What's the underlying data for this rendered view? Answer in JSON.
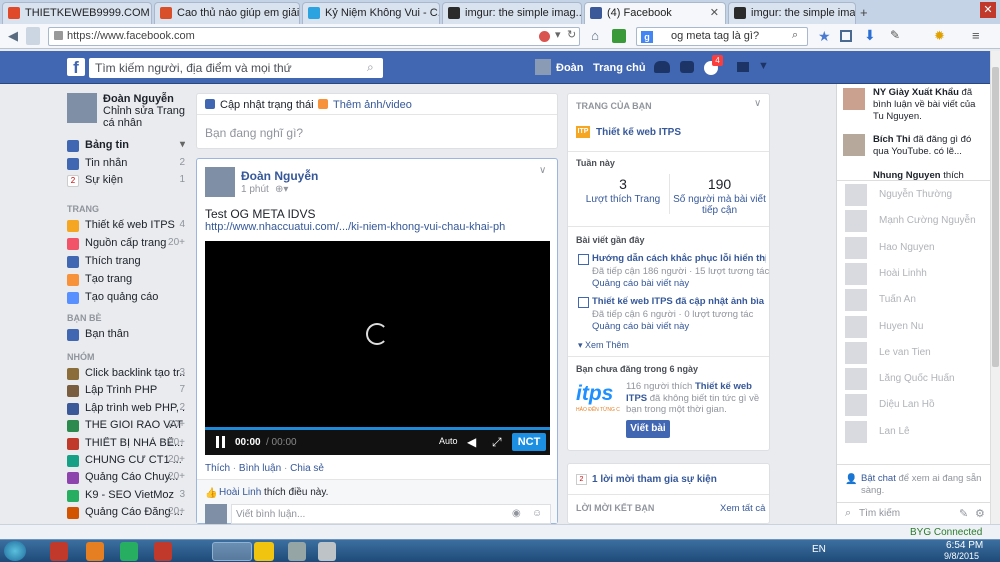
{
  "browser": {
    "tabs": [
      {
        "label": "THIETKEWEB9999.COM",
        "active": false
      },
      {
        "label": "Cao thủ nào giúp em giải th...",
        "active": false
      },
      {
        "label": "Kỷ Niệm Không Vui - C...",
        "active": false
      },
      {
        "label": "imgur: the simple imag...",
        "active": false
      },
      {
        "label": "(4) Facebook",
        "active": true
      },
      {
        "label": "imgur: the simple imag...",
        "active": false
      }
    ],
    "url": "https://www.facebook.com",
    "search_value": "og meta tag là gì?"
  },
  "fb_header": {
    "logo": "f",
    "search_placeholder": "Tìm kiếm người, địa điểm và mọi thứ",
    "profile_name": "Đoàn",
    "home": "Trang chủ",
    "notif_count": "4"
  },
  "left": {
    "profile_name": "Đoàn Nguyễn",
    "edit_profile": "Chỉnh sửa Trang cá nhân",
    "main_items": [
      {
        "label": "Bảng tin",
        "count": "",
        "color": "#4267b2",
        "bold": true
      },
      {
        "label": "Tin nhắn",
        "count": "2",
        "color": "#4267b2"
      },
      {
        "label": "Sự kiện",
        "count": "1",
        "color": "#ffffff"
      }
    ],
    "pages_header": "TRANG",
    "pages_items": [
      {
        "label": "Thiết kế web ITPS",
        "count": "4",
        "color": "#f5a623"
      },
      {
        "label": "Nguồn cấp trang",
        "count": "20+",
        "color": "#f35369"
      },
      {
        "label": "Thích trang",
        "count": "",
        "color": "#4267b2"
      },
      {
        "label": "Tạo trang",
        "count": "",
        "color": "#f7923a"
      },
      {
        "label": "Tạo quảng cáo",
        "count": "",
        "color": "#5890ff"
      }
    ],
    "friends_header": "BẠN BÈ",
    "friends_items": [
      {
        "label": "Bạn thân",
        "count": "",
        "color": "#4267b2"
      }
    ],
    "groups_header": "NHÓM",
    "groups_items": [
      {
        "label": "Click backlink tạo tr...",
        "count": "3",
        "color": "#8a6d3b"
      },
      {
        "label": "Lập Trình PHP",
        "count": "7",
        "color": "#7a5c3e"
      },
      {
        "label": "Lập trình web PHP, ...",
        "count": "2",
        "color": "#3b5998"
      },
      {
        "label": "THE GIOI RAO VAT",
        "count": "20+",
        "color": "#2d8a4e"
      },
      {
        "label": "THIẾT BỊ NHÀ BẾ...",
        "count": "20+",
        "color": "#c0392b"
      },
      {
        "label": "CHUNG CƯ CT1 ...",
        "count": "20+",
        "color": "#16a085"
      },
      {
        "label": "Quảng Cáo Chuy...",
        "count": "20+",
        "color": "#8e44ad"
      },
      {
        "label": "K9 - SEO VietMoz",
        "count": "3",
        "color": "#27ae60"
      },
      {
        "label": "Quảng Cáo Đăng ...",
        "count": "20+",
        "color": "#d35400"
      }
    ]
  },
  "composer": {
    "tab_status": "Cập nhật trạng thái",
    "tab_photo": "Thêm ảnh/video",
    "placeholder": "Bạn đang nghĩ gì?"
  },
  "post": {
    "author": "Đoàn Nguyễn",
    "time": "1 phút",
    "text": "Test OG META IDVS",
    "link": "http://www.nhaccuatui.com/.../ki-niem-khong-vui-chau-khai-pho...",
    "player_time": "00:00",
    "player_duration": "/ 00:00",
    "auto_label": "Auto",
    "brand": "NCT",
    "actions": [
      "Thích",
      "Bình luận",
      "Chia sẻ"
    ],
    "liker": "Hoài Linh",
    "like_text": "thích điều này.",
    "comment_placeholder": "Viết bình luận..."
  },
  "pages_panel": {
    "header": "TRANG CỦA BẠN",
    "page_name": "Thiết kế web ITPS",
    "week_label": "Tuần này",
    "likes_value": "3",
    "likes_label": "Lượt thích Trang",
    "reach_value": "190",
    "reach_label": "Số người mà bài viết tiếp cận",
    "recent_header": "Bài viết gần đây",
    "posts": [
      {
        "title": "Hướng dẫn cách khắc phục lỗi hiển thị ...",
        "stats": "Đã tiếp cận 186 người · 15 lượt tương tác",
        "promote": "Quảng cáo bài viết này"
      },
      {
        "title": "Thiết kế web ITPS đã cập nhật ảnh bìa ...",
        "stats": "Đã tiếp cận 6 người · 0 lượt tương tác",
        "promote": "Quảng cáo bài viết này"
      }
    ],
    "see_more": "Xem Thêm",
    "no_post_header": "Bạn chưa đăng trong 6 ngày",
    "logo_text": "itps",
    "logo_sub": "HẢO ĐẾN TỪNG C",
    "no_post_count": "116 người thích",
    "no_post_page": "Thiết kế web ITPS",
    "no_post_rest": "đã không biết tin tức gì về bạn trong một thời gian.",
    "write_button": "Viết bài"
  },
  "events_panel": {
    "invite": "1 lời mời tham gia sự kiện",
    "friend_suggest": "LỜI MỜI KẾT BẠN",
    "see_all": "Xem tất cả"
  },
  "ticker": [
    {
      "name": "NY Giày Xuất Khẩu",
      "text": "đã bình luận về bài viết của Tu Nguyen."
    },
    {
      "name": "Bích Thi",
      "text": "đã đăng gì đó qua YouTube. có lẽ..."
    },
    {
      "name": "Nhung Nguyen",
      "text": "thích trang"
    }
  ],
  "chat_friends": [
    "Nguyễn Thường",
    "Mạnh Cường Nguyễn",
    "Hao Nguyen",
    "Hoài Linhh",
    "Tuấn An",
    "Huyen Nu",
    "Le van Tien",
    "Lăng Quốc Huấn",
    "Diệu Lan Hồ",
    "Lan Lê"
  ],
  "chat": {
    "enable_link": "Bật chat",
    "enable_text": "để xem ai đang sẵn sàng.",
    "search_placeholder": "Tìm kiếm"
  },
  "status_bar": {
    "byg": "BYG Connected"
  },
  "taskbar": {
    "lang": "EN",
    "time": "6:54 PM",
    "date": "9/8/2015"
  }
}
